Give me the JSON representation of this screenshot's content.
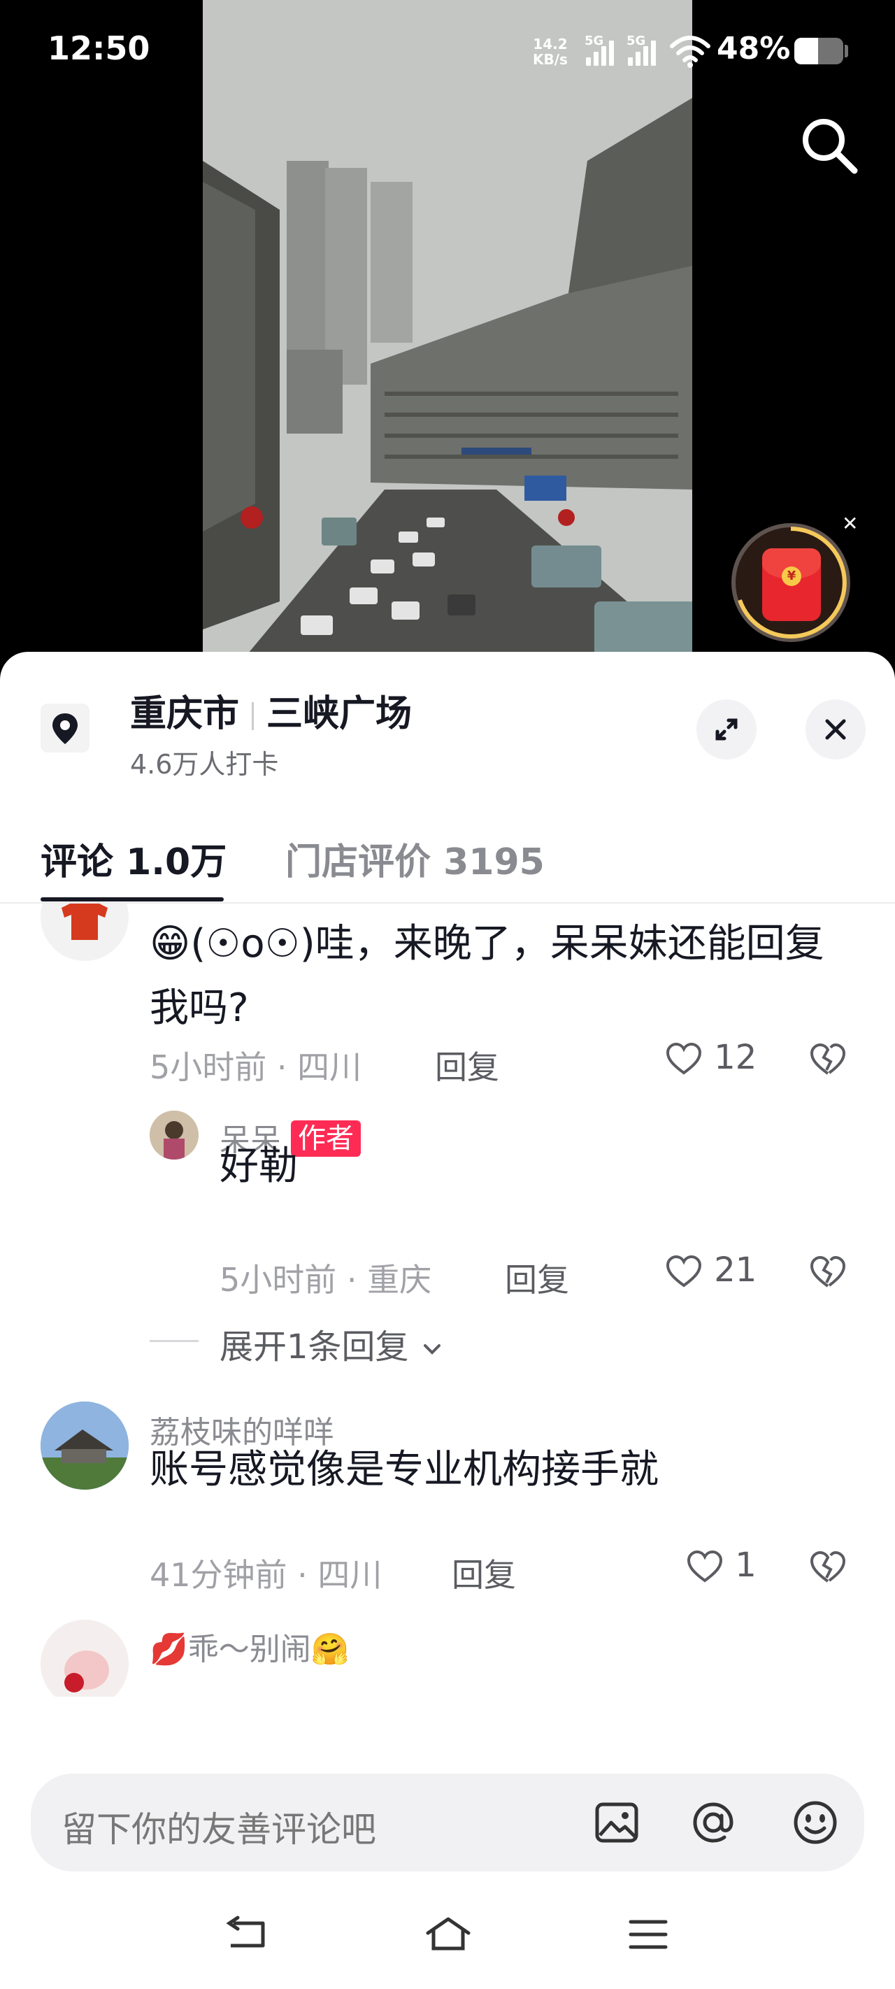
{
  "status": {
    "time": "12:50",
    "net_speed": "14.2",
    "net_unit": "KB/s",
    "sim1": "5G",
    "sim2": "5G",
    "battery_pct": "48%",
    "battery_level": 0.48
  },
  "location": {
    "city": "重庆市",
    "place": "三峡广场",
    "checkins": "4.6万人打卡"
  },
  "tabs": [
    {
      "label": "评论 1.0万",
      "active": true
    },
    {
      "label": "门店评价 3195",
      "active": false
    }
  ],
  "comments": [
    {
      "text": "😁(☉o☉)哇，来晚了，呆呆妹还能回复我吗?",
      "meta": "5小时前 · 四川",
      "reply_label": "回复",
      "likes": "12",
      "reply": {
        "name": "呆呆",
        "tag": "作者",
        "text": "好勒",
        "meta": "5小时前 · 重庆",
        "reply_label": "回复",
        "likes": "21"
      },
      "expand_label": "展开1条回复"
    },
    {
      "name": "荔枝味的咩咩",
      "text": "账号感觉像是专业机构接手就",
      "meta": "41分钟前 · 四川",
      "reply_label": "回复",
      "likes": "1"
    },
    {
      "name": "💋乖～别闹🤗"
    }
  ],
  "input": {
    "placeholder": "留下你的友善评论吧"
  },
  "icons": [
    "search-icon",
    "red-packet-icon",
    "location-pin-icon",
    "expand-icon",
    "close-icon",
    "heart-icon",
    "broken-heart-icon",
    "chevron-down-icon",
    "image-icon",
    "at-icon",
    "emoji-icon",
    "back-icon",
    "home-icon",
    "menu-icon"
  ],
  "colors": {
    "author_tag": "#fe2c55",
    "text": "#161823"
  }
}
